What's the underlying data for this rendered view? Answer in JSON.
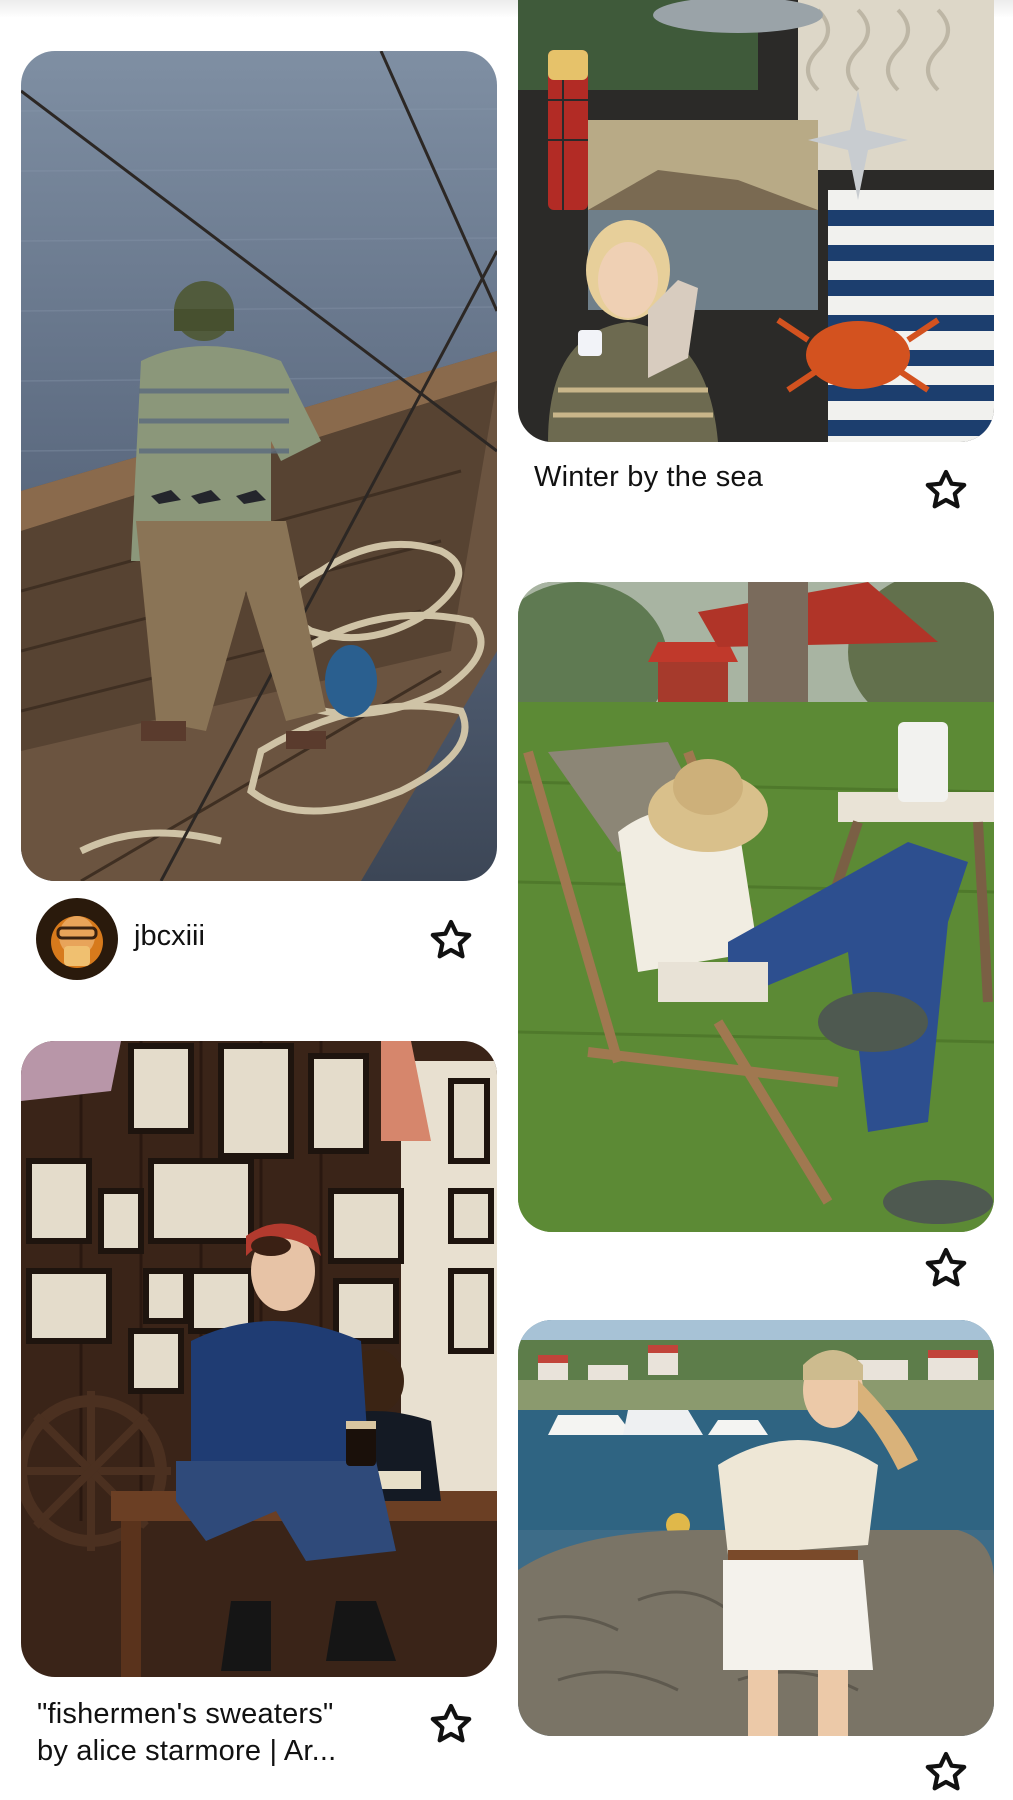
{
  "pins": [
    {
      "id": "pin-boat",
      "image_desc": "person in striped sweater on wooden boat with ropes",
      "author": "jbcxiii",
      "caption": ""
    },
    {
      "id": "pin-winter",
      "image_desc": "collage: woman in sweater, crab, socks, thermos, striped shirts",
      "caption": "Winter by the sea"
    },
    {
      "id": "pin-garden",
      "image_desc": "woman in bucket hat on deck chair in garden with red house",
      "caption": ""
    },
    {
      "id": "pin-pub",
      "image_desc": "woman in navy cable sweater with pint in room of framed photos",
      "caption_line1": "\"fishermen's sweaters\"",
      "caption_line2": "by alice starmore | Ar..."
    },
    {
      "id": "pin-harbor",
      "image_desc": "woman in cream cable knit sweater by harbor with boats",
      "caption": ""
    }
  ],
  "icons": {
    "save": "star-outline-icon"
  },
  "colors": {
    "background": "#ffffff",
    "text": "#111111",
    "star_stroke": "#111111"
  }
}
